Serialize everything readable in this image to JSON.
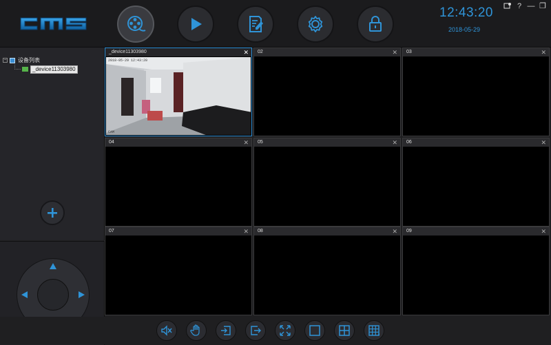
{
  "app": {
    "logo_text": "CMS"
  },
  "nav": [
    {
      "name": "live-view",
      "icon": "film-reel-icon",
      "active": true
    },
    {
      "name": "playback",
      "icon": "play-icon"
    },
    {
      "name": "log",
      "icon": "edit-document-icon"
    },
    {
      "name": "settings",
      "icon": "gear-icon"
    },
    {
      "name": "lock",
      "icon": "lock-icon"
    }
  ],
  "clock": {
    "time": "12:43:20",
    "date": "2018-05-29"
  },
  "window_controls": [
    "settings-chat-icon",
    "help-icon",
    "minimize-icon",
    "restore-icon"
  ],
  "window_control_glyphs": {
    "help": "?",
    "minimize": "—",
    "restore": "❐"
  },
  "device_tree": {
    "root_label": "设备列表",
    "devices": [
      {
        "label": "_device11303980",
        "selected": true
      }
    ]
  },
  "grid": {
    "cells": [
      {
        "label": "_device11303980",
        "active": true,
        "has_video": true
      },
      {
        "label": "02"
      },
      {
        "label": "03"
      },
      {
        "label": "04"
      },
      {
        "label": "05"
      },
      {
        "label": "06"
      },
      {
        "label": "07"
      },
      {
        "label": "08"
      },
      {
        "label": "09"
      }
    ],
    "close_glyph": "✕"
  },
  "toolbar": [
    "mute-icon",
    "hand-icon",
    "import-icon",
    "export-icon",
    "fullscreen-icon",
    "single-view-icon",
    "quad-view-icon",
    "nine-view-icon"
  ],
  "colors": {
    "accent": "#2f94d8",
    "logo": "#1f7fc6",
    "background": "#1f1f21"
  }
}
